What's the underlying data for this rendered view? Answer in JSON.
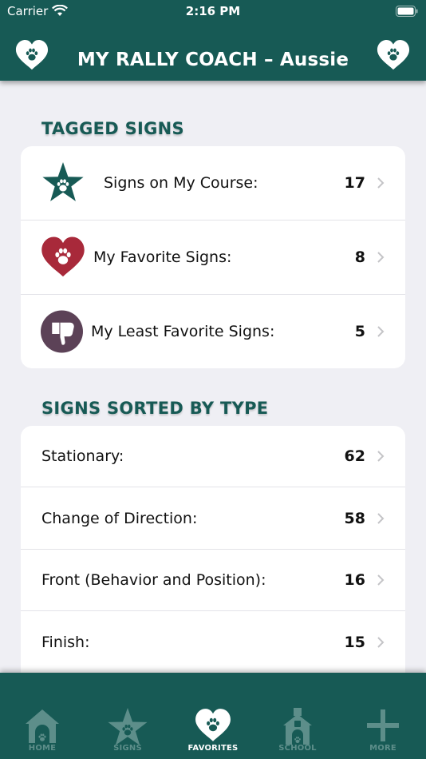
{
  "status_bar": {
    "carrier": "Carrier",
    "time": "2:16 PM"
  },
  "header": {
    "title": "MY RALLY COACH – Aussie"
  },
  "sections": {
    "tagged": {
      "title": "TAGGED SIGNS",
      "rows": [
        {
          "label": "Signs on My Course:",
          "count": "17",
          "icon": "star-paw-icon"
        },
        {
          "label": "My Favorite Signs:",
          "count": "8",
          "icon": "heart-paw-icon"
        },
        {
          "label": "My Least Favorite Signs:",
          "count": "5",
          "icon": "thumbs-down-icon"
        }
      ]
    },
    "by_type": {
      "title": "SIGNS SORTED BY TYPE",
      "rows": [
        {
          "label": "Stationary:",
          "count": "62"
        },
        {
          "label": "Change of Direction:",
          "count": "58"
        },
        {
          "label": "Front (Behavior and Position):",
          "count": "16"
        },
        {
          "label": "Finish:",
          "count": "15"
        }
      ]
    }
  },
  "tab_bar": {
    "tabs": [
      {
        "label": "HOME",
        "icon": "doghouse-icon"
      },
      {
        "label": "SIGNS",
        "icon": "star-paw-icon"
      },
      {
        "label": "FAVORITES",
        "icon": "heart-paw-icon"
      },
      {
        "label": "SCHOOL",
        "icon": "school-icon"
      },
      {
        "label": "MORE",
        "icon": "plus-icon"
      }
    ],
    "active": "FAVORITES"
  },
  "colors": {
    "brand_green": "#175a55",
    "heart_red": "#a8293a",
    "thumb_purple": "#5c4257",
    "background": "#efeff4"
  }
}
